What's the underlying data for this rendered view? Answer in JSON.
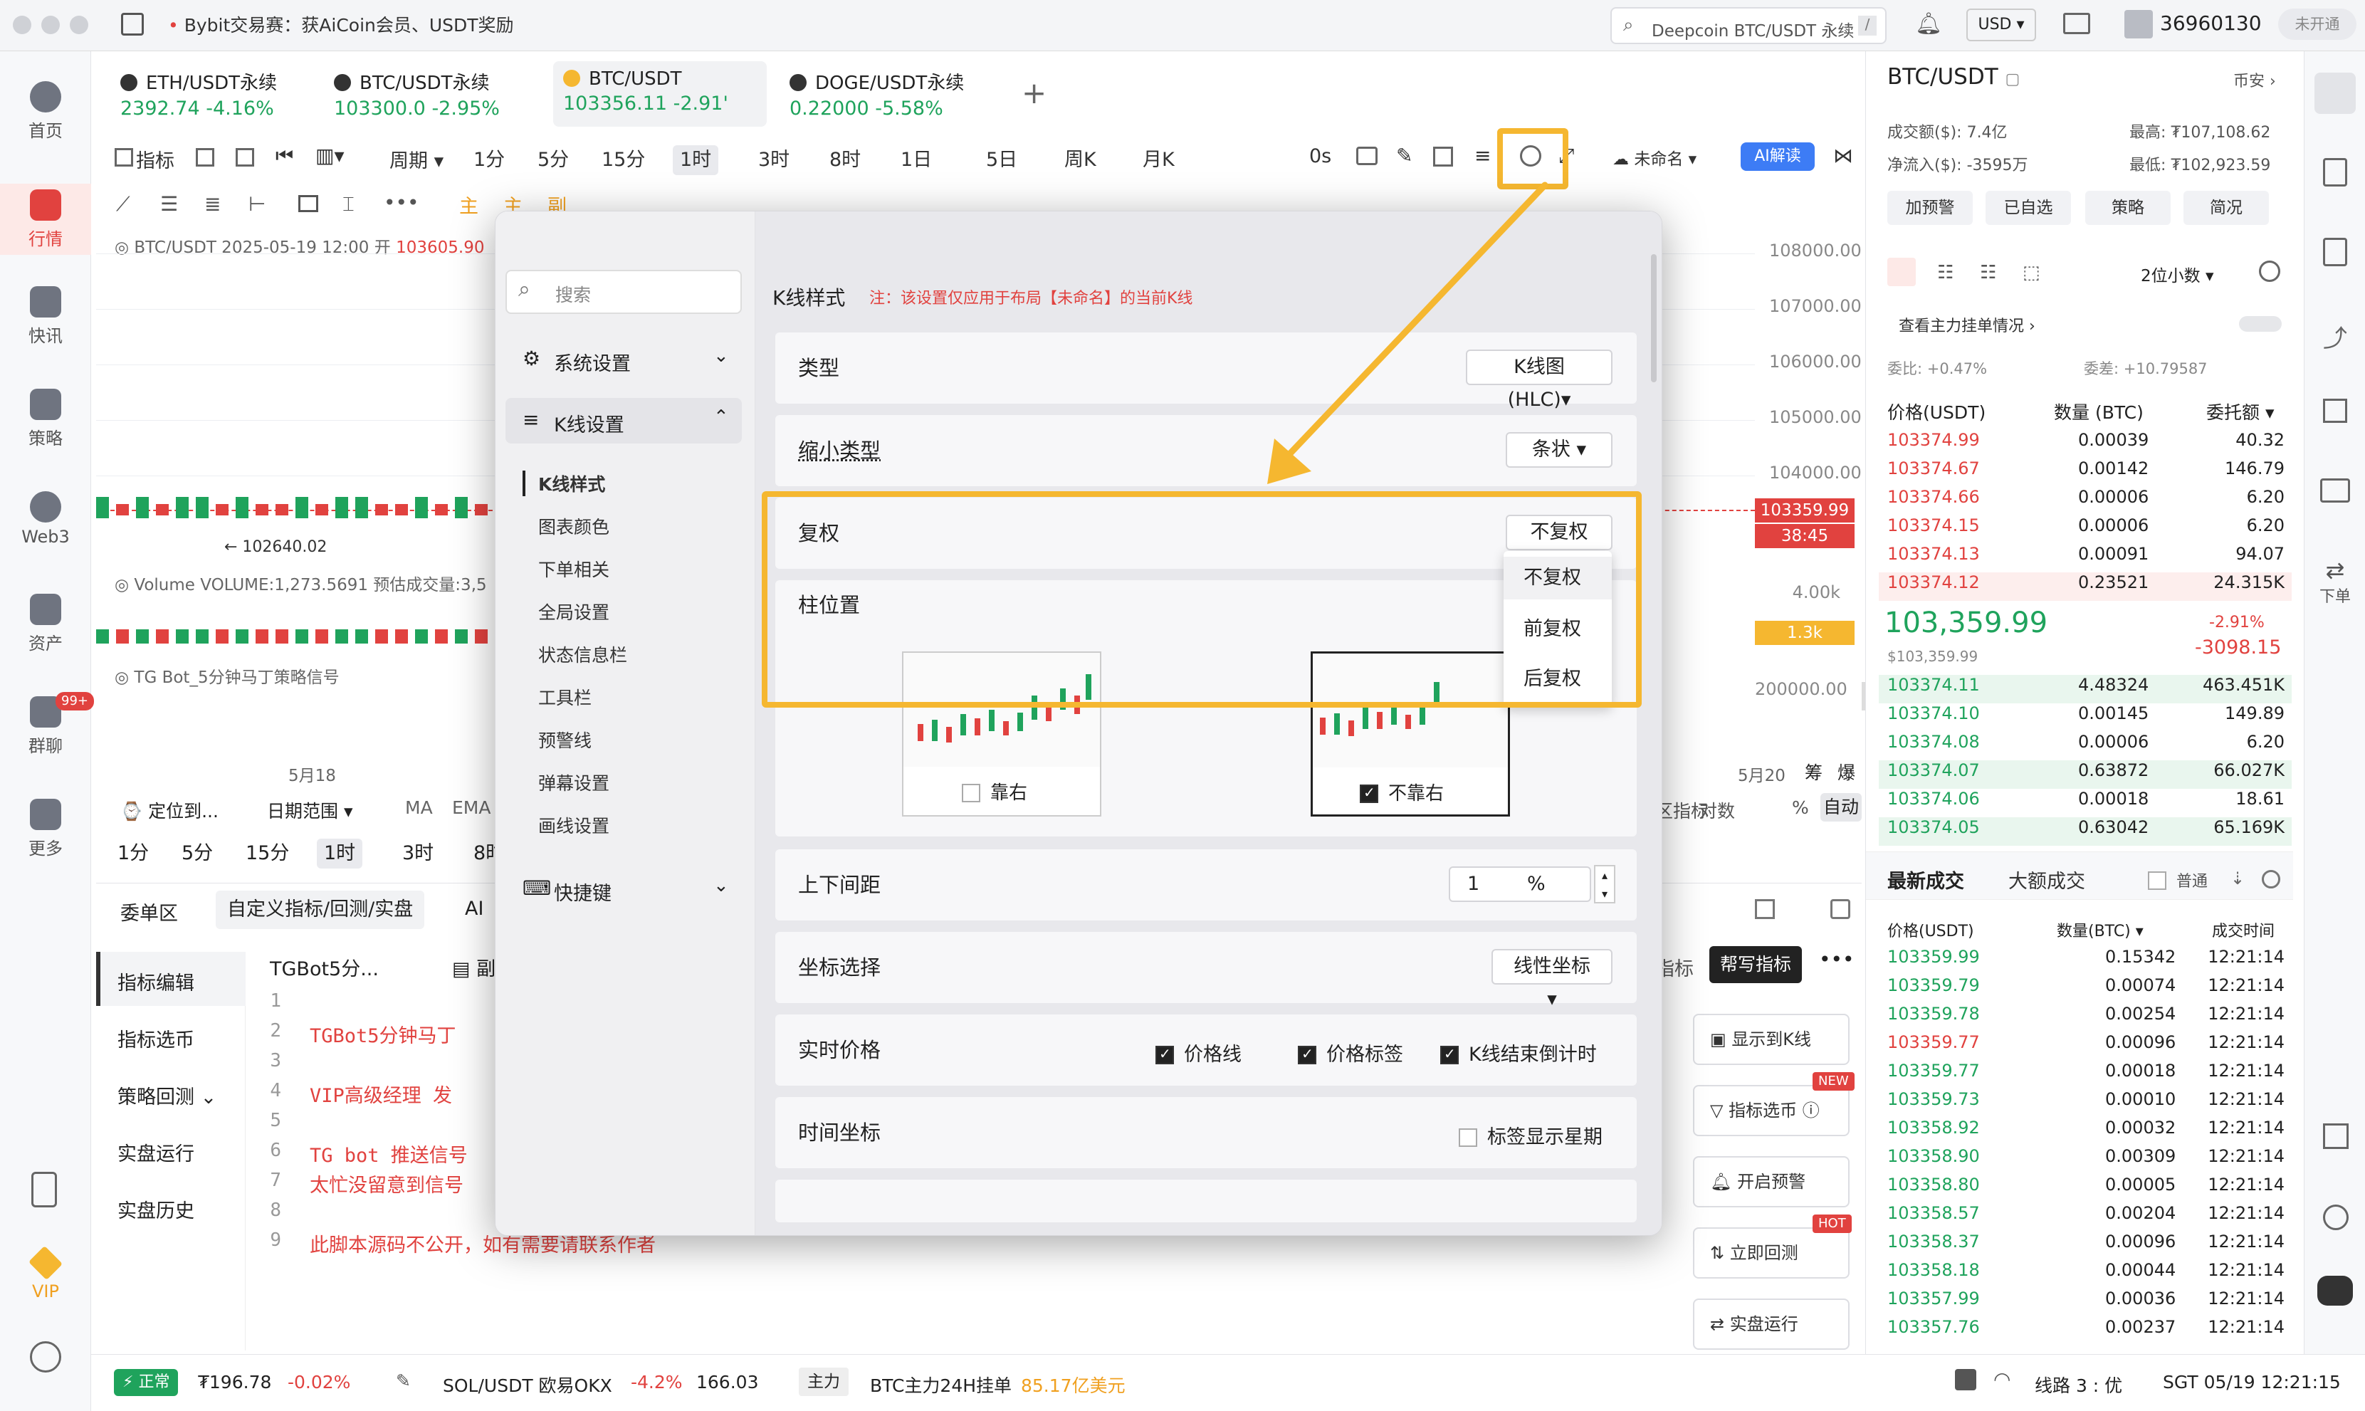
{
  "window": {
    "announce": "Bybit交易赛：获AiCoin会员、USDT奖励",
    "search_placeholder": "Deepcoin BTC/USDT 永续",
    "search_shortcut": "/",
    "currency": "USD",
    "user_id": "36960130",
    "user_status": "未开通"
  },
  "leftnav": [
    {
      "label": "首页"
    },
    {
      "label": "行情"
    },
    {
      "label": "快讯"
    },
    {
      "label": "策略"
    },
    {
      "label": "Web3"
    },
    {
      "label": "资产"
    },
    {
      "label": "群聊",
      "badge": "99+"
    },
    {
      "label": "更多"
    },
    {
      "label": "VIP"
    }
  ],
  "tabs": [
    {
      "name": "ETH/USDT永续",
      "price": "2392.74",
      "change": "-4.16%"
    },
    {
      "name": "BTC/USDT永续",
      "price": "103300.0",
      "change": "-2.95%"
    },
    {
      "name": "BTC/USDT",
      "price": "103356.11",
      "change": "-2.91'"
    },
    {
      "name": "DOGE/USDT永续",
      "price": "0.22000",
      "change": "-5.58%"
    }
  ],
  "toolbar": {
    "indicator": "指标",
    "period": "周期",
    "intervals": [
      "1分",
      "5分",
      "15分",
      "1时",
      "3时",
      "8时",
      "1日",
      "5日",
      "周K",
      "月K"
    ],
    "zero": "0s",
    "layout": "未命名",
    "ai": "AI解读"
  },
  "drawtools": {
    "main": "主",
    "sub": "主",
    "other": "副"
  },
  "chart": {
    "info": "BTC/USDT  2025-05-19 12:00  开",
    "open": "103605.90",
    "low_mark": "← 102640.02",
    "volume": "Volume  VOLUME:1,273.5691  预估成交量:3,5",
    "strategy": "TG Bot_5分钟马丁策略信号",
    "price_axis": [
      "108000.00",
      "107000.00",
      "106000.00",
      "105000.00",
      "104000.00"
    ],
    "cur_price": "103359.99",
    "countdown": "38:45",
    "vol_axis": "4.00k",
    "vol_tag": "1.3k",
    "ind_axis": "200000.00",
    "date_left": "5月18",
    "date_right": "5月20",
    "foot_a": "筹",
    "foot_b": "爆"
  },
  "chart_bottom": {
    "locate": "定位到...",
    "date_range": "日期范围",
    "ma": "MA",
    "ema": "EMA",
    "intervals": [
      "1分",
      "5分",
      "15分",
      "1时",
      "3时",
      "8时"
    ],
    "right": [
      "区指标",
      "对数",
      "%",
      "自动"
    ]
  },
  "bottom": {
    "tabs": [
      "委单区",
      "自定义指标/回测/实盘",
      "AI"
    ],
    "side": [
      "指标编辑",
      "指标选币",
      "策略回测",
      "实盘运行",
      "实盘历史"
    ],
    "script_name": "TGBot5分...",
    "script_tab2": "副图",
    "help": "帮写指标",
    "tab_right": "指标",
    "buttons": [
      {
        "label": "显示到K线"
      },
      {
        "label": "指标选币",
        "badge": "NEW"
      },
      {
        "label": "开启预警"
      },
      {
        "label": "立即回测",
        "badge": "HOT"
      },
      {
        "label": "实盘运行"
      }
    ],
    "code": [
      "",
      "TGBot5分钟马丁",
      "",
      "VIP高级经理 发",
      "",
      "TG bot 推送信号",
      "太忙没留意到信号",
      "",
      "此脚本源码不公开，如有需要请联系作者"
    ]
  },
  "dialog": {
    "search": "搜索",
    "groups": [
      {
        "label": "系统设置"
      },
      {
        "label": "K线设置"
      },
      {
        "label": "快捷键"
      }
    ],
    "sub": [
      "K线样式",
      "图表颜色",
      "下单相关",
      "全局设置",
      "状态信息栏",
      "工具栏",
      "预警线",
      "弹幕设置",
      "画线设置"
    ],
    "header": "K线样式",
    "note": "注：该设置仅应用于布局【未命名】的当前K线",
    "rows": {
      "type_label": "类型",
      "type_value": "K线图 (HLC)",
      "shrink_label": "缩小类型",
      "shrink_value": "条状",
      "adj_label": "复权",
      "adj_value": "不复权",
      "pos_label": "柱位置",
      "pos_left": "靠右",
      "pos_right": "不靠右",
      "gap_label": "上下间距",
      "gap_value": "1",
      "gap_unit": "%",
      "axis_label": "坐标选择",
      "axis_value": "线性坐标",
      "rt_label": "实时价格",
      "rt_opts": [
        "价格线",
        "价格标签",
        "K线结束倒计时"
      ],
      "time_label": "时间坐标",
      "time_opt": "标签显示星期"
    },
    "dropdown": [
      "不复权",
      "前复权",
      "后复权"
    ]
  },
  "right": {
    "symbol": "BTC/USDT",
    "exchange": "币安",
    "vol": "成交额($): 7.4亿",
    "inflow": "净流入($): -3595万",
    "high": "最高: ₮107,108.62",
    "low": "最低: ₮102,923.59",
    "buttons": [
      "加预警",
      "已自选",
      "策略",
      "简况"
    ],
    "decimals": "2位小数",
    "main_orders": "查看主力挂单情况",
    "bid_ratio": "委比: +0.47%",
    "bid_diff": "委差: +10.79587",
    "cols": [
      "价格(USDT)",
      "数量 (BTC)",
      "委托额"
    ],
    "asks": [
      [
        "103374.99",
        "0.00039",
        "40.32"
      ],
      [
        "103374.67",
        "0.00142",
        "146.79"
      ],
      [
        "103374.66",
        "0.00006",
        "6.20"
      ],
      [
        "103374.15",
        "0.00006",
        "6.20"
      ],
      [
        "103374.13",
        "0.00091",
        "94.07"
      ],
      [
        "103374.12",
        "0.23521",
        "24.315K"
      ]
    ],
    "mid": "103,359.99",
    "mid_usd": "$103,359.99",
    "mid_pct": "-2.91%",
    "mid_chg": "-3098.15",
    "bids": [
      [
        "103374.11",
        "4.48324",
        "463.451K"
      ],
      [
        "103374.10",
        "0.00145",
        "149.89"
      ],
      [
        "103374.08",
        "0.00006",
        "6.20"
      ],
      [
        "103374.07",
        "0.63872",
        "66.027K"
      ],
      [
        "103374.06",
        "0.00018",
        "18.61"
      ],
      [
        "103374.05",
        "0.63042",
        "65.169K"
      ]
    ],
    "trade_tabs": [
      "最新成交",
      "大额成交",
      "普通"
    ],
    "trade_cols": [
      "价格(USDT)",
      "数量(BTC)",
      "成交时间"
    ],
    "trades": [
      [
        "103359.99",
        "0.15342",
        "12:21:14",
        "g"
      ],
      [
        "103359.79",
        "0.00074",
        "12:21:14",
        "g"
      ],
      [
        "103359.78",
        "0.00254",
        "12:21:14",
        "g"
      ],
      [
        "103359.77",
        "0.00096",
        "12:21:14",
        "r"
      ],
      [
        "103359.77",
        "0.00018",
        "12:21:14",
        "g"
      ],
      [
        "103359.73",
        "0.00010",
        "12:21:14",
        "g"
      ],
      [
        "103358.92",
        "0.00032",
        "12:21:14",
        "g"
      ],
      [
        "103358.90",
        "0.00309",
        "12:21:14",
        "g"
      ],
      [
        "103358.80",
        "0.00005",
        "12:21:14",
        "g"
      ],
      [
        "103358.57",
        "0.00204",
        "12:21:14",
        "g"
      ],
      [
        "103358.37",
        "0.00096",
        "12:21:14",
        "g"
      ],
      [
        "103358.18",
        "0.00044",
        "12:21:14",
        "g"
      ],
      [
        "103357.99",
        "0.00036",
        "12:21:14",
        "g"
      ],
      [
        "103357.76",
        "0.00237",
        "12:21:14",
        "g"
      ]
    ]
  },
  "rightnav": [
    "下单"
  ],
  "status": {
    "state": "正常",
    "price": "₮196.78",
    "pct": "-0.02%",
    "pair": "SOL/USDT 欧易OKX",
    "pair_pct": "-4.2%",
    "pair_price": "166.03",
    "tag": "主力",
    "news": "BTC主力24H挂单",
    "news_val": "85.17亿美元",
    "line": "线路 3 : 优",
    "time": "SGT 05/19 12:21:15"
  }
}
